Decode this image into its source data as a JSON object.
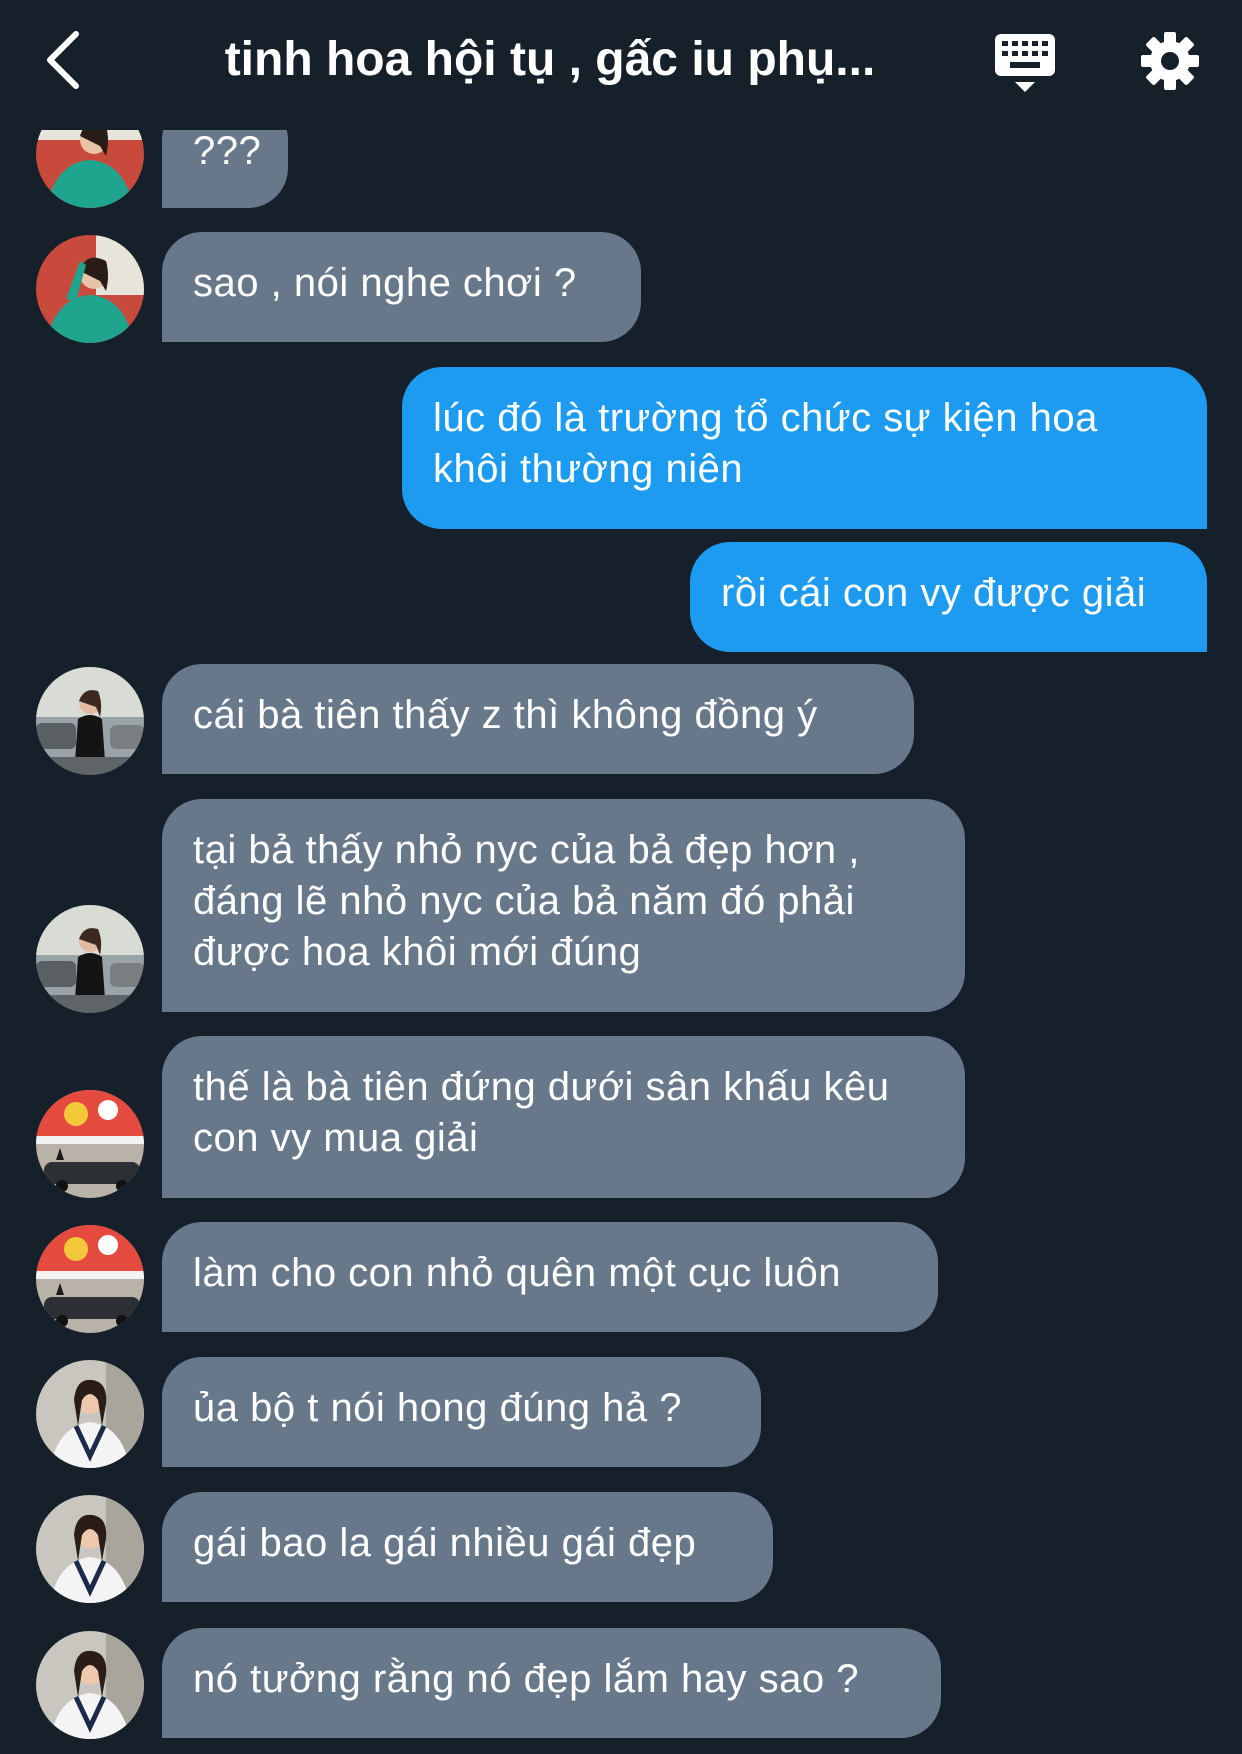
{
  "header": {
    "title": "tinh hoa hội tụ , gấc iu phụ...",
    "back_icon": "chevron-left-icon",
    "keyboard_icon": "keyboard-icon",
    "settings_icon": "gear-icon"
  },
  "colors": {
    "background": "#16202b",
    "incoming_bubble": "#66788a",
    "outgoing_bubble": "#1d9bf0",
    "text": "#ffffff"
  },
  "messages": [
    {
      "side": "in",
      "sender": "a",
      "text": "???"
    },
    {
      "side": "in",
      "sender": "a",
      "text": "sao , nói nghe chơi ?"
    },
    {
      "side": "out",
      "lines": [
        "lúc đó là trường tổ chức sự kiện hoa",
        "khôi thường niên"
      ]
    },
    {
      "side": "out",
      "text": "rồi cái con vy được giải"
    },
    {
      "side": "in",
      "sender": "b",
      "text": "cái bà tiên thấy z thì không đồng ý"
    },
    {
      "side": "in",
      "sender": "b",
      "lines": [
        "tại bả thấy nhỏ nyc của bả đẹp hơn ,",
        "đáng lẽ nhỏ nyc của bả năm đó phải",
        "được hoa khôi mới đúng"
      ]
    },
    {
      "side": "in",
      "sender": "c",
      "lines": [
        "thế là bà tiên đứng dưới sân khấu kêu",
        "con vy mua giải"
      ]
    },
    {
      "side": "in",
      "sender": "c",
      "text": "làm cho con nhỏ quên một cục luôn"
    },
    {
      "side": "in",
      "sender": "d",
      "text": "ủa bộ t nói hong đúng hả ?"
    },
    {
      "side": "in",
      "sender": "d",
      "text": "gái bao la gái nhiều gái đẹp"
    },
    {
      "side": "in",
      "sender": "d",
      "text": "nó tưởng rằng nó đẹp lắm hay sao ?"
    }
  ]
}
